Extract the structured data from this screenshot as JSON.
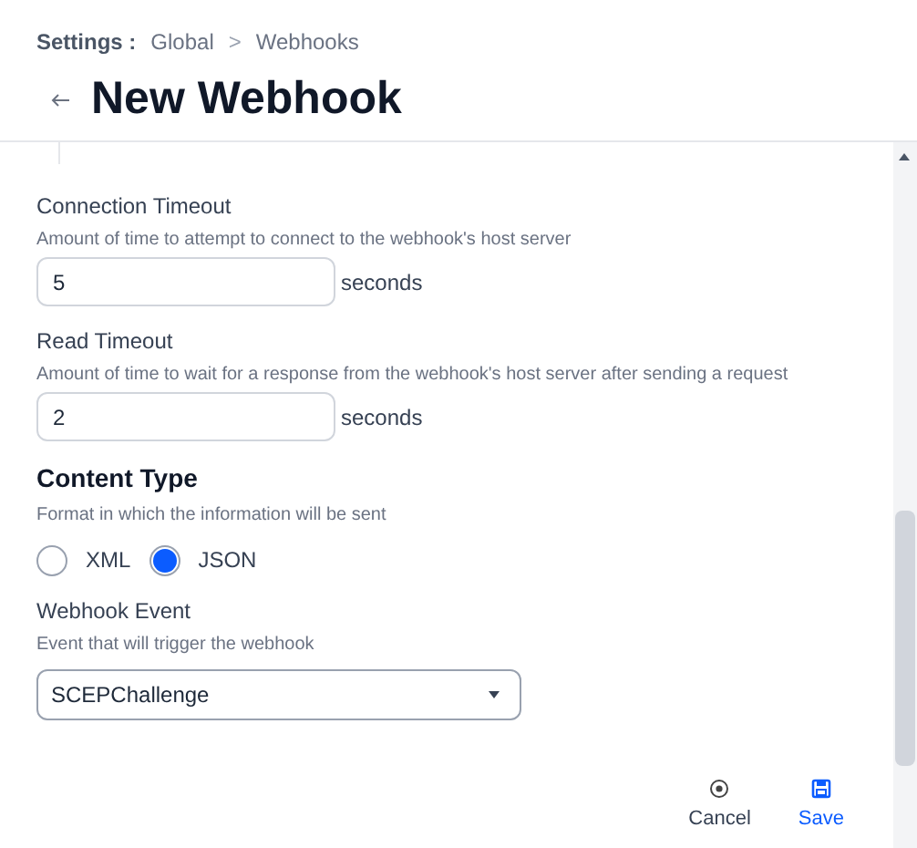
{
  "breadcrumb": {
    "root": "Settings :",
    "items": [
      "Global",
      "Webhooks"
    ],
    "separator": ">"
  },
  "title": "New Webhook",
  "fields": [
    {
      "kind": "number",
      "label": "Connection Timeout",
      "hint": "Amount of time to attempt to connect to the webhook's host server",
      "value": "5",
      "unit": "seconds"
    },
    {
      "kind": "number",
      "label": "Read Timeout",
      "hint": "Amount of time to wait for a response from the webhook's host server after sending a request",
      "value": "2",
      "unit": "seconds"
    },
    {
      "kind": "radio",
      "label": "Content Type",
      "hint": "Format in which the information will be sent",
      "options": [
        {
          "label": "XML",
          "selected": false
        },
        {
          "label": "JSON",
          "selected": true
        }
      ]
    },
    {
      "kind": "select",
      "label": "Webhook Event",
      "hint": "Event that will trigger the webhook",
      "value": "SCEPChallenge"
    }
  ],
  "actions": [
    {
      "kind": "cancel",
      "label": "Cancel"
    },
    {
      "kind": "save",
      "label": "Save"
    }
  ]
}
